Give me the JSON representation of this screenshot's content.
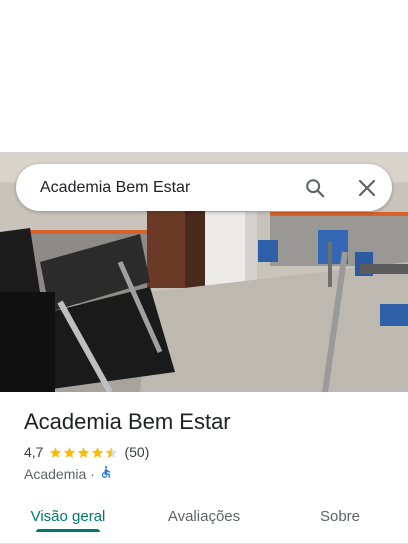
{
  "search": {
    "query": "Academia Bem Estar",
    "icons": [
      "search-icon",
      "close-icon"
    ]
  },
  "place": {
    "name": "Academia Bem Estar",
    "rating": "4,7",
    "stars": 4.5,
    "reviews": "(50)",
    "category": "Academia",
    "separator": "·",
    "accessibility_icon": "wheelchair-icon"
  },
  "tabs": [
    {
      "label": "Visão geral",
      "active": true
    },
    {
      "label": "Avaliações",
      "active": false
    },
    {
      "label": "Sobre",
      "active": false
    }
  ],
  "colors": {
    "accent": "#00796b",
    "star": "#fbbc04",
    "accessibility": "#1a73e8"
  }
}
